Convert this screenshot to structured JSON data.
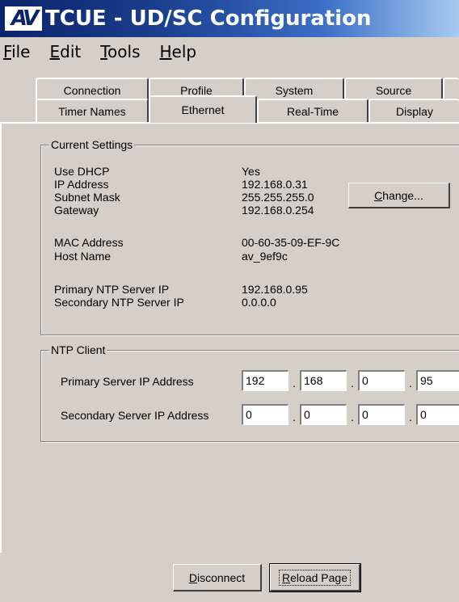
{
  "window": {
    "logo_text": "AV",
    "title": "TCUE - UD/SC Configuration"
  },
  "menu": {
    "file": {
      "first": "F",
      "rest": "ile"
    },
    "edit": {
      "first": "E",
      "rest": "dit"
    },
    "tools": {
      "first": "T",
      "rest": "ools"
    },
    "help": {
      "first": "H",
      "rest": "elp"
    }
  },
  "tabs": {
    "row1": [
      "Connection",
      "Profile",
      "System",
      "Source"
    ],
    "row2": [
      "Timer Names",
      "Ethernet",
      "Real-Time",
      "Display"
    ],
    "active": "Ethernet"
  },
  "current_settings": {
    "legend": "Current Settings",
    "use_dhcp_label": "Use DHCP",
    "use_dhcp_value": "Yes",
    "ip_label": "IP Address",
    "ip_value": "192.168.0.31",
    "subnet_label": "Subnet Mask",
    "subnet_value": "255.255.255.0",
    "gateway_label": "Gateway",
    "gateway_value": "192.168.0.254",
    "mac_label": "MAC Address",
    "mac_value": "00-60-35-09-EF-9C",
    "host_label": "Host Name",
    "host_value": "av_9ef9c",
    "ntp1_label": "Primary NTP Server IP",
    "ntp1_value": "192.168.0.95",
    "ntp2_label": "Secondary NTP Server IP",
    "ntp2_value": "0.0.0.0",
    "change_button": {
      "first": "C",
      "rest": "hange..."
    }
  },
  "ntp_client": {
    "legend": "NTP Client",
    "primary_label": "Primary Server IP Address",
    "primary_octets": [
      "192",
      "168",
      "0",
      "95"
    ],
    "secondary_label": "Secondary Server IP Address",
    "secondary_octets": [
      "0",
      "0",
      "0",
      "0"
    ],
    "separator": "."
  },
  "footer": {
    "disconnect": {
      "first": "D",
      "rest": "isconnect"
    },
    "reload": {
      "first": "R",
      "rest": "eload Page"
    }
  }
}
